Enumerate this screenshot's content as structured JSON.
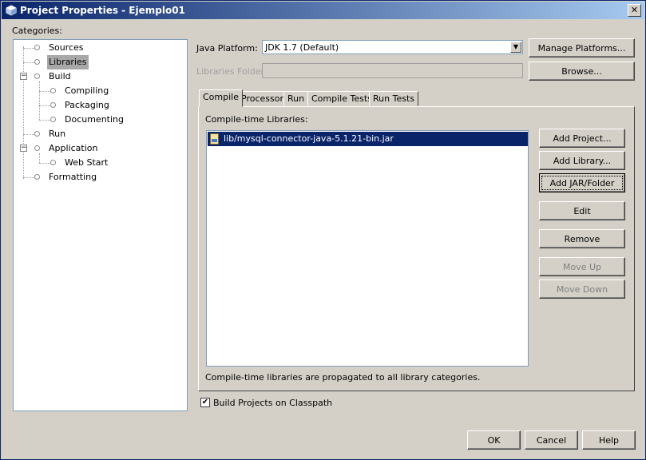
{
  "window": {
    "title": "Project Properties - Ejemplo01",
    "icon": "netbeans-project-icon",
    "close_glyph": "✕"
  },
  "categories": {
    "label": "Categories:",
    "items": [
      {
        "label": "Sources",
        "selected": false
      },
      {
        "label": "Libraries",
        "selected": true
      },
      {
        "label": "Build",
        "expanded": true
      },
      {
        "label": "Compiling"
      },
      {
        "label": "Packaging"
      },
      {
        "label": "Documenting"
      },
      {
        "label": "Run"
      },
      {
        "label": "Application",
        "expanded": true
      },
      {
        "label": "Web Start"
      },
      {
        "label": "Formatting"
      }
    ]
  },
  "platform": {
    "label": "Java Platform:",
    "value": "JDK 1.7 (Default)",
    "manage_button": "Manage Platforms..."
  },
  "libraries_folder": {
    "label": "Libraries Folder:",
    "value": "",
    "browse_button": "Browse..."
  },
  "tabs": [
    {
      "label": "Compile",
      "active": true
    },
    {
      "label": "Processor"
    },
    {
      "label": "Run"
    },
    {
      "label": "Compile Tests"
    },
    {
      "label": "Run Tests"
    }
  ],
  "compile": {
    "list_label": "Compile-time Libraries:",
    "libraries": [
      "lib/mysql-connector-java-5.1.21-bin.jar"
    ],
    "note": "Compile-time libraries are propagated to all library categories.",
    "buttons": {
      "add_project": "Add Project...",
      "add_library": "Add Library...",
      "add_jar": "Add JAR/Folder",
      "edit": "Edit",
      "remove": "Remove",
      "move_up": "Move Up",
      "move_down": "Move Down"
    }
  },
  "build_on_classpath": {
    "label": "Build Projects on Classpath",
    "checked": true,
    "check_glyph": "✔"
  },
  "footer": {
    "ok": "OK",
    "cancel": "Cancel",
    "help": "Help"
  },
  "colors": {
    "title_gradient_start": "#0a246a",
    "title_gradient_end": "#a6caf0",
    "selection": "#0a246a",
    "dialog_bg": "#d4d0c8"
  }
}
